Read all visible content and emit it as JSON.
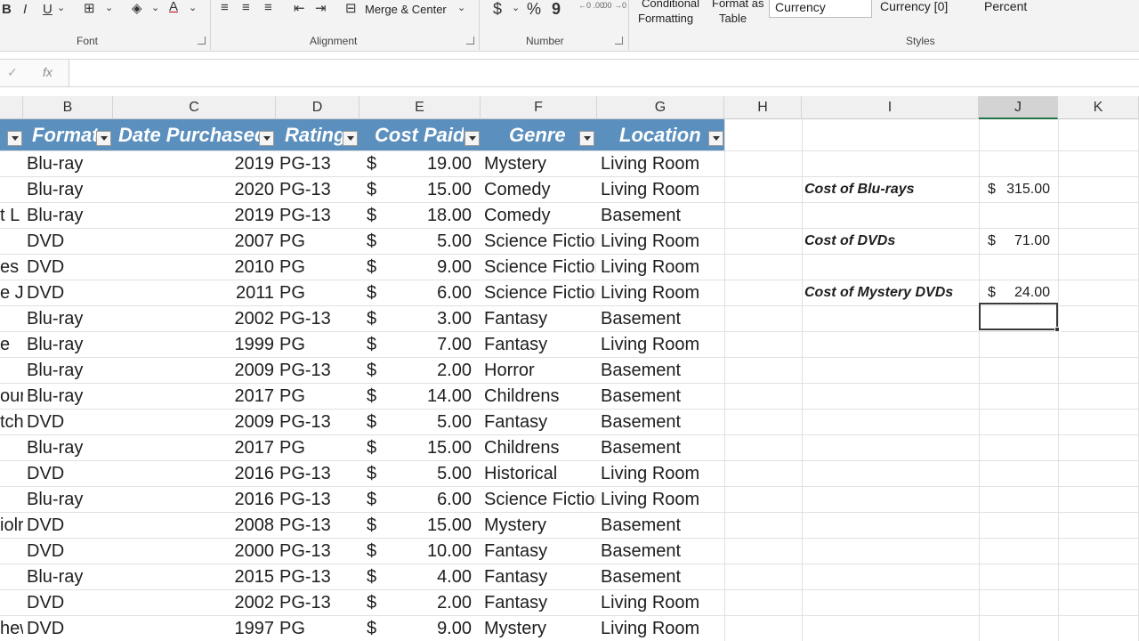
{
  "ribbon": {
    "font_group": "Font",
    "alignment_group": "Alignment",
    "number_group": "Number",
    "styles_group": "Styles",
    "merge_center": "Merge & Center",
    "conditional_formatting_1": "Conditional",
    "conditional_formatting_2": "Formatting",
    "format_as_table_1": "Format as",
    "format_as_table_2": "Table",
    "style_currency": "Currency",
    "style_currency0": "Currency [0]",
    "style_percent": "Percent",
    "bold": "B",
    "italic": "I",
    "underline": "U",
    "dollar": "$",
    "percent_sign": "%",
    "comma": "9",
    "inc_decimal": "←0 .00",
    "dec_decimal": ".00 →0"
  },
  "formula_bar": {
    "check": "✓",
    "fx": "fx",
    "value": ""
  },
  "columns": [
    "B",
    "C",
    "D",
    "E",
    "F",
    "G",
    "H",
    "I",
    "J",
    "K"
  ],
  "table": {
    "headers": [
      "Format",
      "Date Purchased",
      "Rating",
      "Cost Paid",
      "Genre",
      "Location"
    ],
    "rows": [
      {
        "a": "",
        "format": "Blu-ray",
        "year": "2019",
        "rating": "PG-13",
        "cur": "$",
        "cost": "19.00",
        "genre": "Mystery",
        "loc": "Living Room"
      },
      {
        "a": "",
        "format": "Blu-ray",
        "year": "2020",
        "rating": "PG-13",
        "cur": "$",
        "cost": "15.00",
        "genre": "Comedy",
        "loc": "Living Room"
      },
      {
        "a": "t L",
        "format": "Blu-ray",
        "year": "2019",
        "rating": "PG-13",
        "cur": "$",
        "cost": "18.00",
        "genre": "Comedy",
        "loc": "Basement"
      },
      {
        "a": "",
        "format": "DVD",
        "year": "2007",
        "rating": "PG",
        "cur": "$",
        "cost": "5.00",
        "genre": "Science Fiction",
        "loc": "Living Room"
      },
      {
        "a": "es E",
        "format": "DVD",
        "year": "2010",
        "rating": "PG",
        "cur": "$",
        "cost": "9.00",
        "genre": "Science Fiction",
        "loc": "Living Room"
      },
      {
        "a": "e Je",
        "format": "DVD",
        "year": "2011",
        "rating": "PG",
        "cur": "$",
        "cost": "6.00",
        "genre": "Science Fiction",
        "loc": "Living Room"
      },
      {
        "a": "",
        "format": "Blu-ray",
        "year": "2002",
        "rating": "PG-13",
        "cur": "$",
        "cost": "3.00",
        "genre": "Fantasy",
        "loc": "Basement"
      },
      {
        "a": "e",
        "format": "Blu-ray",
        "year": "1999",
        "rating": "PG",
        "cur": "$",
        "cost": "7.00",
        "genre": "Fantasy",
        "loc": "Living Room"
      },
      {
        "a": "",
        "format": "Blu-ray",
        "year": "2009",
        "rating": "PG-13",
        "cur": "$",
        "cost": "2.00",
        "genre": "Horror",
        "loc": "Basement"
      },
      {
        "a": "our",
        "format": "Blu-ray",
        "year": "2017",
        "rating": "PG",
        "cur": "$",
        "cost": "14.00",
        "genre": "Childrens",
        "loc": "Basement"
      },
      {
        "a": "tch",
        "format": "DVD",
        "year": "2009",
        "rating": "PG-13",
        "cur": "$",
        "cost": "5.00",
        "genre": "Fantasy",
        "loc": "Basement"
      },
      {
        "a": "",
        "format": "Blu-ray",
        "year": "2017",
        "rating": "PG",
        "cur": "$",
        "cost": "15.00",
        "genre": "Childrens",
        "loc": "Basement"
      },
      {
        "a": "",
        "format": "DVD",
        "year": "2016",
        "rating": "PG-13",
        "cur": "$",
        "cost": "5.00",
        "genre": "Historical",
        "loc": "Living Room"
      },
      {
        "a": "",
        "format": "Blu-ray",
        "year": "2016",
        "rating": "PG-13",
        "cur": "$",
        "cost": "6.00",
        "genre": "Science Fiction",
        "loc": "Living Room"
      },
      {
        "a": "iolr",
        "format": "DVD",
        "year": "2008",
        "rating": "PG-13",
        "cur": "$",
        "cost": "15.00",
        "genre": "Mystery",
        "loc": "Basement"
      },
      {
        "a": "",
        "format": "DVD",
        "year": "2000",
        "rating": "PG-13",
        "cur": "$",
        "cost": "10.00",
        "genre": "Fantasy",
        "loc": "Basement"
      },
      {
        "a": "",
        "format": "Blu-ray",
        "year": "2015",
        "rating": "PG-13",
        "cur": "$",
        "cost": "4.00",
        "genre": "Fantasy",
        "loc": "Basement"
      },
      {
        "a": "",
        "format": "DVD",
        "year": "2002",
        "rating": "PG-13",
        "cur": "$",
        "cost": "2.00",
        "genre": "Fantasy",
        "loc": "Living Room"
      },
      {
        "a": "hew",
        "format": "DVD",
        "year": "1997",
        "rating": "PG",
        "cur": "$",
        "cost": "9.00",
        "genre": "Mystery",
        "loc": "Living Room"
      }
    ]
  },
  "summary": [
    {
      "label": "Cost of Blu-rays",
      "cur": "$",
      "value": "315.00"
    },
    {
      "label": "Cost of DVDs",
      "cur": "$",
      "value": "71.00"
    },
    {
      "label": "Cost of Mystery DVDs",
      "cur": "$",
      "value": "24.00"
    }
  ],
  "colors": {
    "table_header": "#5b8fbd",
    "selection_border": "#3a3a3a"
  }
}
